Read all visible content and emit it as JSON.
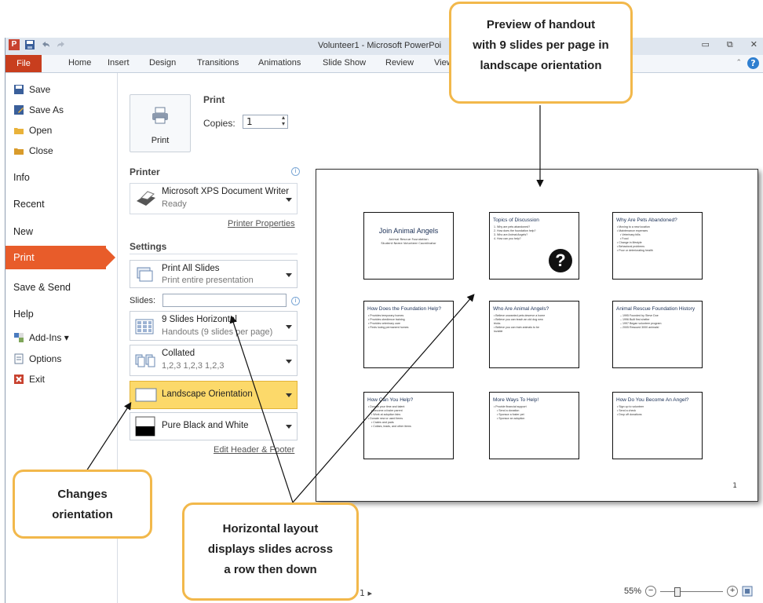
{
  "window": {
    "title": "Volunteer1 - Microsoft PowerPoi",
    "logo_letter": "P",
    "controls": [
      "▭",
      "⧉",
      "✕"
    ]
  },
  "ribbon": {
    "file_tab": "File",
    "tabs": [
      "Home",
      "Insert",
      "Design",
      "Transitions",
      "Animations",
      "Slide Show",
      "Review",
      "View"
    ],
    "help": "?",
    "collapse": "⌃"
  },
  "backstage": {
    "save": "Save",
    "save_as": "Save As",
    "open": "Open",
    "close": "Close",
    "info": "Info",
    "recent": "Recent",
    "new": "New",
    "print": "Print",
    "save_send": "Save & Send",
    "help": "Help",
    "add_ins": "Add-Ins ▾",
    "options": "Options",
    "exit": "Exit"
  },
  "print_panel": {
    "heading": "Print",
    "print_button": "Print",
    "copies_label": "Copies:",
    "copies_value": "1",
    "printer_heading": "Printer",
    "printer_name": "Microsoft XPS Document Writer",
    "printer_status": "Ready",
    "printer_properties": "Printer Properties",
    "settings_heading": "Settings",
    "slides_label": "Slides:",
    "slides_value": "",
    "settings": [
      {
        "title": "Print All Slides",
        "sub": "Print entire presentation"
      },
      {
        "title": "9 Slides Horizontal",
        "sub": "Handouts (9 slides per page)"
      },
      {
        "title": "Collated",
        "sub": "1,2,3   1,2,3   1,2,3"
      },
      {
        "title": "Landscape Orientation",
        "sub": ""
      },
      {
        "title": "Pure Black and White",
        "sub": ""
      }
    ],
    "edit_header_footer": "Edit Header & Footer",
    "info_icon": "i"
  },
  "preview": {
    "page_number": "1",
    "slides": [
      {
        "title": "Join Animal Angels",
        "lines": [
          "Animal Rescue Foundation",
          "Student Name  Volunteer Coordinator"
        ]
      },
      {
        "title": "Topics of Discussion",
        "lines": [
          "1. Why are pets abandoned?",
          "2. How does the foundation help?",
          "3. Who are Animal Angels?",
          "4. How can you help?"
        ],
        "badge": "?"
      },
      {
        "title": "Why Are Pets Abandoned?",
        "lines": [
          "• Moving to a new location",
          "• Maintenance expenses",
          "    • Veterinary bills",
          "    • Food",
          "• Change in lifestyle",
          "• Behavioral problems",
          "• Poor or deteriorating health"
        ]
      },
      {
        "title": "How Does the Foundation Help?",
        "lines": [
          "• Provides temporary homes",
          "• Provides obedience training",
          "• Provides veterinary care",
          "• Finds loving permanent homes"
        ]
      },
      {
        "title": "Who Are Animal Angels?",
        "lines": [
          "• Believe unwanted pets deserve a home",
          "• Believe you can teach an old dog new",
          "   tricks",
          "• Believe you can train animals to be",
          "   lovable"
        ]
      },
      {
        "title": "Animal Rescue Foundation History",
        "lines": [
          "– 1995   Founded by Steve Doe",
          "– 1996   Built first shelter",
          "– 1997   Began volunteer program",
          "– 2005   Rescued 3000 animals!"
        ]
      },
      {
        "title": "How Can You Help?",
        "lines": [
          "• Donate your time and talent",
          "    • Become a foster parent",
          "    • Work at adoption fairs",
          "• Donate new or used items",
          "    • Crates and pads",
          "    • Collars, leads, and other items"
        ]
      },
      {
        "title": "More Ways To Help!",
        "lines": [
          "• Provide financial support",
          "    • Send a donation",
          "    • Sponsor a foster pet",
          "    • Sponsor an adoption"
        ]
      },
      {
        "title": "How Do You Become An Angel?",
        "lines": [
          "• Sign up to volunteer",
          "• Send a check",
          "• Drop off donations"
        ]
      }
    ]
  },
  "status": {
    "page_nav": "1 ▸",
    "zoom": "55%",
    "zoom_minus": "−",
    "zoom_plus": "+"
  },
  "callouts": {
    "preview": [
      "Preview of handout",
      "with 9 slides per page in",
      "landscape orientation"
    ],
    "orientation": [
      "Changes",
      "orientation"
    ],
    "horizontal": [
      "Horizontal layout",
      "displays slides across",
      "a row then down"
    ]
  },
  "colors": {
    "accent": "#e85c2a",
    "file_tab": "#c83e1e",
    "callout_border": "#f2b84b",
    "selected_setting": "#fcd96a"
  }
}
